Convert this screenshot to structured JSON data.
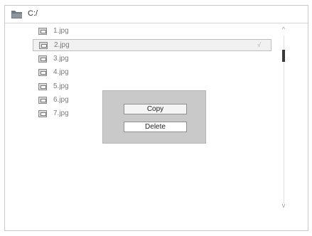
{
  "path_bar": {
    "path": "C:/",
    "icon": "folder-icon"
  },
  "files": [
    {
      "name": "1.jpg",
      "icon": "image-file-icon",
      "selected": false,
      "check": ""
    },
    {
      "name": "2.jpg",
      "icon": "image-file-icon",
      "selected": true,
      "check": "√"
    },
    {
      "name": "3.jpg",
      "icon": "image-file-icon",
      "selected": false,
      "check": ""
    },
    {
      "name": "4.jpg",
      "icon": "image-file-icon",
      "selected": false,
      "check": ""
    },
    {
      "name": "5.jpg",
      "icon": "image-file-icon",
      "selected": false,
      "check": ""
    },
    {
      "name": "6.jpg",
      "icon": "image-file-icon",
      "selected": false,
      "check": ""
    },
    {
      "name": "7.jpg",
      "icon": "image-file-icon",
      "selected": false,
      "check": ""
    }
  ],
  "scrollbar": {
    "up_icon": "chevron-up-icon",
    "down_icon": "chevron-down-icon",
    "up_glyph": "^",
    "down_glyph": "v"
  },
  "context_menu": {
    "copy_label": "Copy",
    "delete_label": "Delete"
  },
  "colors": {
    "popup_bg": "#c9c9c9",
    "selected_row_bg": "#f1f1f1",
    "thumb": "#3a3a3a"
  }
}
